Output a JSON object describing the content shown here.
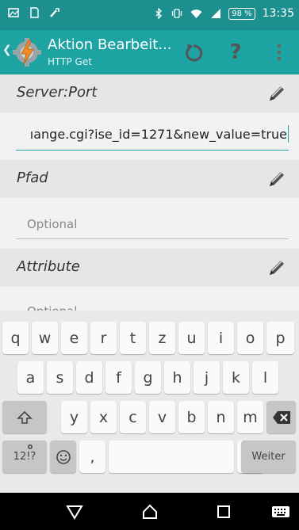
{
  "status_bar": {
    "battery": "98 %",
    "time": "13:35"
  },
  "action_bar": {
    "title": "Aktion Bearbeit...",
    "subtitle": "HTTP Get",
    "help_label": "?"
  },
  "sections": {
    "server_port": {
      "label": "Server:Port",
      "value": "ıange.cgi?ise_id=1271&new_value=true"
    },
    "pfad": {
      "label": "Pfad",
      "placeholder": "Optional"
    },
    "attribute": {
      "label": "Attribute",
      "placeholder": "Optional"
    }
  },
  "keyboard": {
    "row1": [
      "q",
      "w",
      "e",
      "r",
      "t",
      "z",
      "u",
      "i",
      "o",
      "p"
    ],
    "row2": [
      "a",
      "s",
      "d",
      "f",
      "g",
      "h",
      "j",
      "k",
      "l"
    ],
    "row3": [
      "y",
      "x",
      "c",
      "v",
      "b",
      "n",
      "m"
    ],
    "row4": {
      "symbols": "12!?",
      "comma": ",",
      "period": ".",
      "period_hint": "?!",
      "action": "Weiter"
    }
  },
  "colors": {
    "status_bar": "#1d8f8f",
    "action_bar": "#1ea3a3",
    "accent": "#1ea3a3"
  },
  "icons": {
    "status_left": [
      "gallery-icon",
      "sim-icon",
      "wrench-icon"
    ],
    "status_right": [
      "bluetooth-icon",
      "vibrate-icon",
      "wifi-icon",
      "signal-icon"
    ],
    "nav": [
      "back-icon",
      "home-icon",
      "recents-icon",
      "keyboard-icon"
    ]
  }
}
